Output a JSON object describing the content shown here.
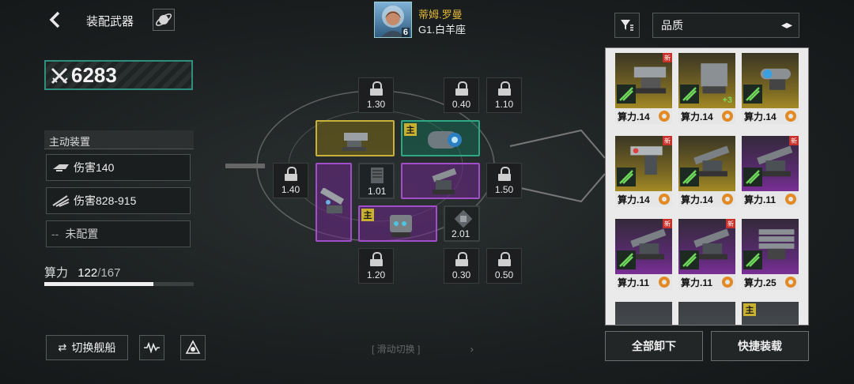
{
  "header": {
    "title": "装配武器",
    "pilot_name": "蒂姆.罗曼",
    "pilot_level": "6",
    "pilot_sign": "G1.白羊座"
  },
  "power": {
    "value": "6283"
  },
  "active_device": {
    "title": "主动装置",
    "items": [
      {
        "label": "伤害140"
      },
      {
        "label": "伤害828-915"
      },
      {
        "dash": "--",
        "label": "未配置"
      }
    ]
  },
  "compute": {
    "label": "算力",
    "used": "122",
    "sep": "/",
    "total": "167",
    "fill_fraction": 0.73
  },
  "locked_slots": [
    {
      "value": "1.30"
    },
    {
      "value": "0.40"
    },
    {
      "value": "1.10"
    },
    {
      "value": "1.40"
    },
    {
      "value": "1.50"
    },
    {
      "value": "1.20"
    },
    {
      "value": "0.30"
    },
    {
      "value": "0.50"
    }
  ],
  "ship_slots": {
    "main_tag": "主",
    "dark1_value": "1.01",
    "dark2_value": "2.01"
  },
  "bottom": {
    "switch_ship": "切换舰船",
    "swipe_hint": "滑动切换"
  },
  "right_panel": {
    "sort_label": "品质",
    "cards": [
      {
        "rarity": "gold",
        "label": "算力.14",
        "new": "新",
        "icon": "cannon-icon"
      },
      {
        "rarity": "gold",
        "label": "算力.14",
        "plus": "+3",
        "icon": "launcher-icon"
      },
      {
        "rarity": "gold",
        "label": "算力.14",
        "icon": "plasma-gun-icon"
      },
      {
        "rarity": "gold",
        "label": "算力.14",
        "new": "新",
        "icon": "rail-gun-icon"
      },
      {
        "rarity": "gold",
        "label": "算力.14",
        "icon": "turret-icon"
      },
      {
        "rarity": "purple",
        "label": "算力.11",
        "new": "新",
        "icon": "turret-icon"
      },
      {
        "rarity": "purple",
        "label": "算力.11",
        "new": "新",
        "icon": "turret-icon"
      },
      {
        "rarity": "purple",
        "label": "算力.11",
        "new": "新",
        "icon": "turret-icon"
      },
      {
        "rarity": "purple",
        "label": "算力.25",
        "icon": "gatling-icon"
      }
    ],
    "unload_all": "全部卸下",
    "quick_equip": "快捷装载"
  },
  "colors": {
    "gold": "#c9b23a",
    "green": "#2fa684",
    "purple": "#a34ec9",
    "accent": "#2e8f7e"
  }
}
